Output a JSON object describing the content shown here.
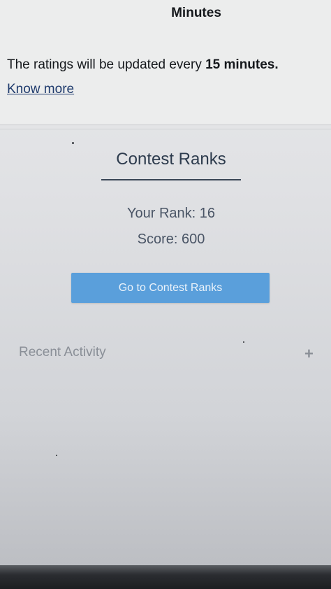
{
  "header": {
    "minutes_heading": "Minutes"
  },
  "info": {
    "ratings_text_prefix": "The ratings will be updated every ",
    "ratings_interval": "15 minutes.",
    "know_more_link": "Know more"
  },
  "contest": {
    "title": "Contest Ranks",
    "rank_text": "Your Rank: 16",
    "score_text": "Score: 600",
    "button_label": "Go to Contest Ranks"
  },
  "recent_activity": {
    "title": "Recent Activity",
    "expand_symbol": "+"
  },
  "colors": {
    "button_bg": "#5a9fdb",
    "title_color": "#2d3b4d",
    "muted_text": "#8a8f97",
    "link_color": "#1f3b6d"
  }
}
